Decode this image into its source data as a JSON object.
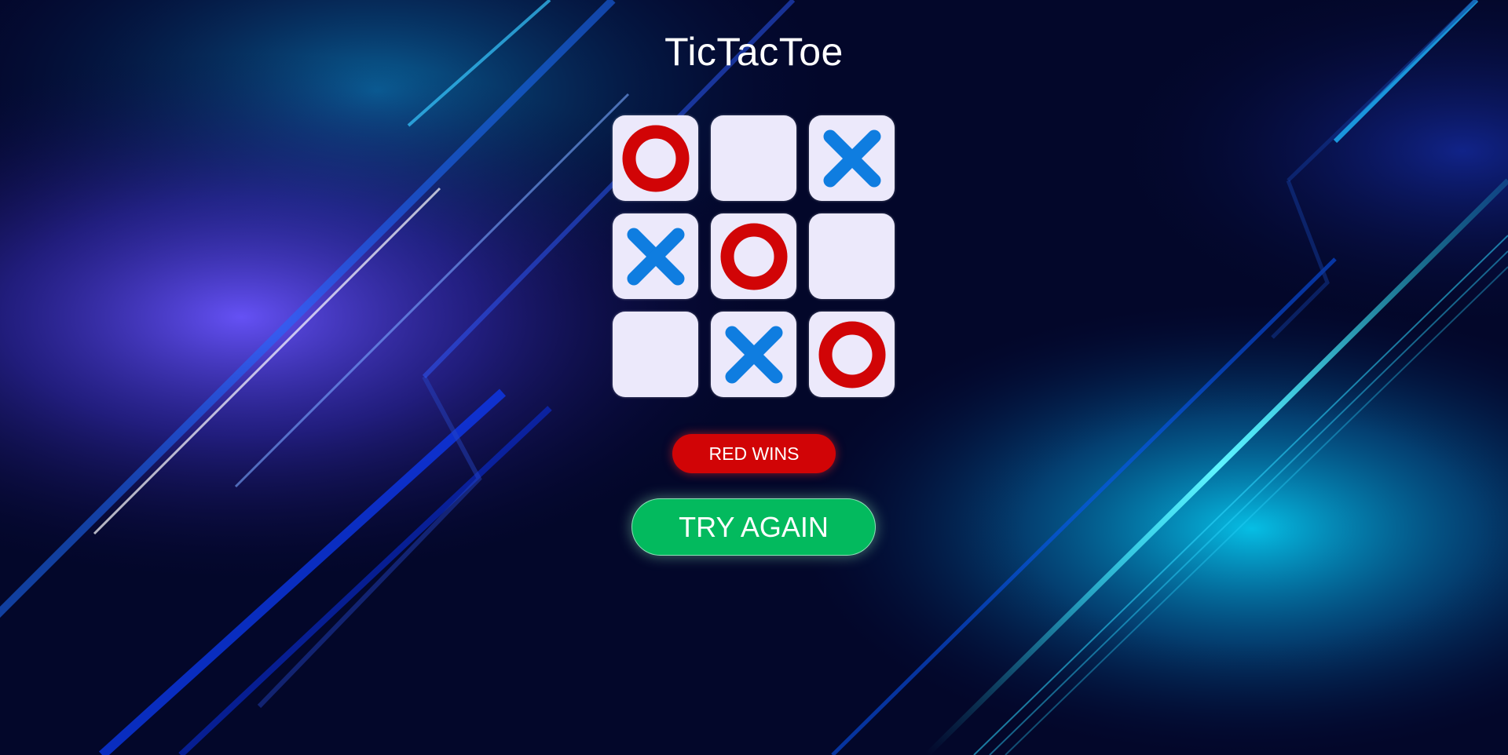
{
  "title": "TicTacToe",
  "board": {
    "cells": [
      {
        "mark": "O"
      },
      {
        "mark": ""
      },
      {
        "mark": "X"
      },
      {
        "mark": "X"
      },
      {
        "mark": "O"
      },
      {
        "mark": ""
      },
      {
        "mark": ""
      },
      {
        "mark": "X"
      },
      {
        "mark": "O"
      }
    ]
  },
  "status": {
    "text": "RED WINS"
  },
  "actions": {
    "try_again_label": "TRY AGAIN"
  },
  "colors": {
    "o_mark": "#d10406",
    "x_mark": "#0f7de0",
    "cell": "#ece9fb",
    "status_bg": "#d10406",
    "button_bg": "#03ba5e"
  },
  "icons": {
    "o_mark": "ring-icon",
    "x_mark": "cross-icon"
  }
}
